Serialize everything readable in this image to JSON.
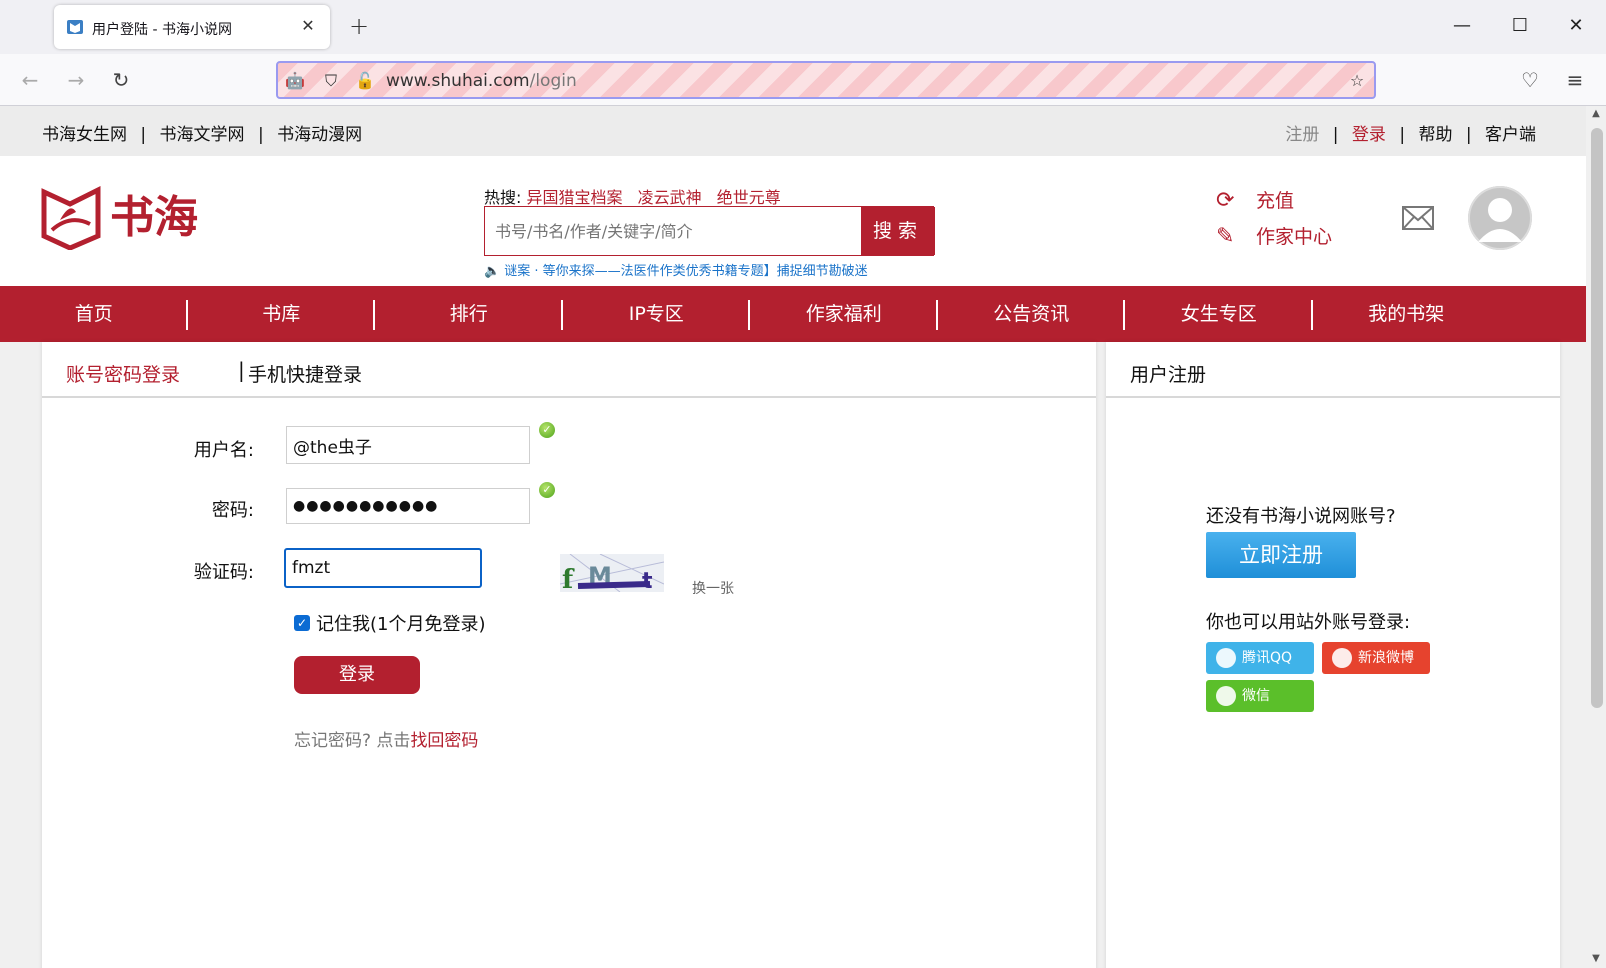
{
  "browser": {
    "tab_title": "用户登陆 - 书海小说网",
    "url_host": "www.shuhai.com",
    "url_path": "/login"
  },
  "topbar": {
    "left_links": [
      "书海女生网",
      "书海文学网",
      "书海动漫网"
    ],
    "right_links": {
      "register": "注册",
      "login": "登录",
      "help": "帮助",
      "client": "客户端"
    }
  },
  "header": {
    "logo_text": "书海",
    "hot_label": "热搜:",
    "hot_items": [
      "异国猎宝档案",
      "凌云武神",
      "绝世元尊"
    ],
    "search_placeholder": "书号/书名/作者/关键字/简介",
    "search_button": "搜索",
    "ticker": "谜案 · 等你来探——法医件作类优秀书籍专题】捕捉细节勘破迷",
    "recharge": "充值",
    "author_center": "作家中心"
  },
  "menu": [
    "首页",
    "书库",
    "排行",
    "IP专区",
    "作家福利",
    "公告资讯",
    "女生专区",
    "我的书架"
  ],
  "login": {
    "tab_account": "账号密码登录",
    "tab_divider": "|",
    "tab_phone": "手机快捷登录",
    "username_label": "用户名:",
    "username_value": "@the虫子",
    "password_label": "密码:",
    "password_value": "●●●●●●●●●●●",
    "captcha_label": "验证码:",
    "captcha_value": "fmzt",
    "captcha_swap": "换一张",
    "remember": "记住我(1个月免登录)",
    "submit": "登录",
    "forgot_prefix": "忘记密码? 点击",
    "forgot_link": "找回密码"
  },
  "register": {
    "title": "用户注册",
    "question": "还没有书海小说网账号?",
    "button": "立即注册",
    "alt_login": "你也可以用站外账号登录:",
    "qq": "腾讯QQ",
    "weibo": "新浪微博",
    "wechat": "微信"
  },
  "colors": {
    "brand_red": "#b3202f",
    "register_blue": "#1f8fd8"
  }
}
